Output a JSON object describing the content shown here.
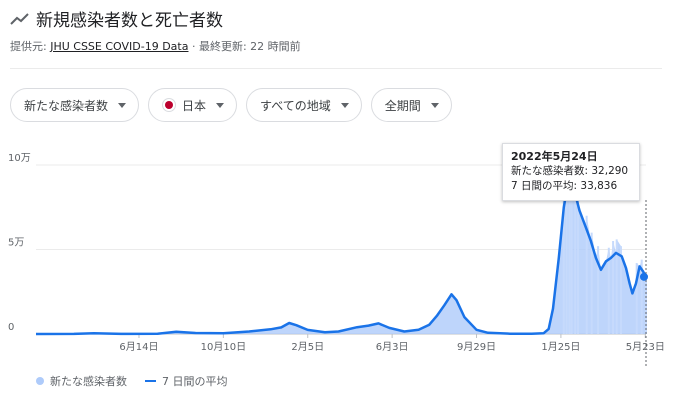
{
  "header": {
    "title": "新規感染者数と死亡者数",
    "source_prefix": "提供元: ",
    "source_link": "JHU CSSE COVID-19 Data",
    "source_suffix": " · 最終更新: 22 時間前"
  },
  "filters": {
    "metric": "新たな感染者数",
    "country": "日本",
    "region": "すべての地域",
    "period": "全期間"
  },
  "tooltip": {
    "date": "2022年5月24日",
    "line1": "新たな感染者数: 32,290",
    "line2": "7 日間の平均: 33,836"
  },
  "legend": {
    "daily": "新たな感染者数",
    "average": "7 日間の平均"
  },
  "colors": {
    "line": "#1a73e8",
    "area": "#aecbfa",
    "axis": "#bdc1c6"
  },
  "chart_data": {
    "type": "area",
    "title": "",
    "xlabel": "",
    "ylabel": "",
    "y_ticks": [
      {
        "value": 0,
        "label": "0"
      },
      {
        "value": 50000,
        "label": "5万"
      },
      {
        "value": 100000,
        "label": "10万"
      }
    ],
    "x_ticks": [
      "6月14日",
      "10月10日",
      "2月5日",
      "6月3日",
      "9月29日",
      "1月25日",
      "5月23日"
    ],
    "x_tick_dates": [
      "2020-06-14",
      "2020-10-10",
      "2021-02-05",
      "2021-06-03",
      "2021-09-29",
      "2022-01-25",
      "2022-05-23"
    ],
    "ylim": [
      0,
      105000
    ],
    "xlim": [
      "2020-01-22",
      "2022-05-24"
    ],
    "series": [
      {
        "name": "7 日間の平均",
        "points": [
          [
            "2020-01-22",
            0
          ],
          [
            "2020-03-15",
            50
          ],
          [
            "2020-04-12",
            500
          ],
          [
            "2020-05-20",
            50
          ],
          [
            "2020-07-10",
            200
          ],
          [
            "2020-08-05",
            1300
          ],
          [
            "2020-09-01",
            600
          ],
          [
            "2020-10-10",
            500
          ],
          [
            "2020-11-15",
            1500
          ],
          [
            "2020-12-15",
            2800
          ],
          [
            "2020-12-30",
            3900
          ],
          [
            "2021-01-10",
            6500
          ],
          [
            "2021-01-20",
            5200
          ],
          [
            "2021-02-05",
            2400
          ],
          [
            "2021-03-01",
            1000
          ],
          [
            "2021-03-20",
            1500
          ],
          [
            "2021-04-15",
            4000
          ],
          [
            "2021-05-01",
            5000
          ],
          [
            "2021-05-15",
            6300
          ],
          [
            "2021-05-30",
            3600
          ],
          [
            "2021-06-20",
            1500
          ],
          [
            "2021-07-10",
            2500
          ],
          [
            "2021-07-25",
            5500
          ],
          [
            "2021-08-05",
            11000
          ],
          [
            "2021-08-15",
            17000
          ],
          [
            "2021-08-25",
            23500
          ],
          [
            "2021-09-01",
            20000
          ],
          [
            "2021-09-12",
            10000
          ],
          [
            "2021-09-29",
            2500
          ],
          [
            "2021-10-15",
            700
          ],
          [
            "2021-11-15",
            200
          ],
          [
            "2021-12-15",
            200
          ],
          [
            "2022-01-01",
            500
          ],
          [
            "2022-01-08",
            3000
          ],
          [
            "2022-01-14",
            15000
          ],
          [
            "2022-01-22",
            45000
          ],
          [
            "2022-01-29",
            75000
          ],
          [
            "2022-02-05",
            92000
          ],
          [
            "2022-02-12",
            86000
          ],
          [
            "2022-02-20",
            73000
          ],
          [
            "2022-03-01",
            63000
          ],
          [
            "2022-03-08",
            55000
          ],
          [
            "2022-03-15",
            45000
          ],
          [
            "2022-03-22",
            38000
          ],
          [
            "2022-03-29",
            43000
          ],
          [
            "2022-04-05",
            45000
          ],
          [
            "2022-04-12",
            48000
          ],
          [
            "2022-04-20",
            46000
          ],
          [
            "2022-04-26",
            39000
          ],
          [
            "2022-05-01",
            30000
          ],
          [
            "2022-05-05",
            24000
          ],
          [
            "2022-05-10",
            30000
          ],
          [
            "2022-05-15",
            40000
          ],
          [
            "2022-05-20",
            37000
          ],
          [
            "2022-05-24",
            33836
          ]
        ]
      },
      {
        "name": "新たな感染者数",
        "points": [
          [
            "2022-01-29",
            84000
          ],
          [
            "2022-02-02",
            102000
          ],
          [
            "2022-02-06",
            96000
          ],
          [
            "2022-02-09",
            104000
          ],
          [
            "2022-02-14",
            90000
          ],
          [
            "2022-02-18",
            86000
          ],
          [
            "2022-03-02",
            70000
          ],
          [
            "2022-03-09",
            60000
          ],
          [
            "2022-03-18",
            52000
          ],
          [
            "2022-04-02",
            51000
          ],
          [
            "2022-04-08",
            55000
          ],
          [
            "2022-04-13",
            56000
          ],
          [
            "2022-04-19",
            52000
          ],
          [
            "2022-05-11",
            42000
          ],
          [
            "2022-05-18",
            44000
          ],
          [
            "2022-05-24",
            32290
          ]
        ]
      }
    ],
    "highlight": {
      "date": "2022-05-24",
      "value": 33836
    }
  }
}
